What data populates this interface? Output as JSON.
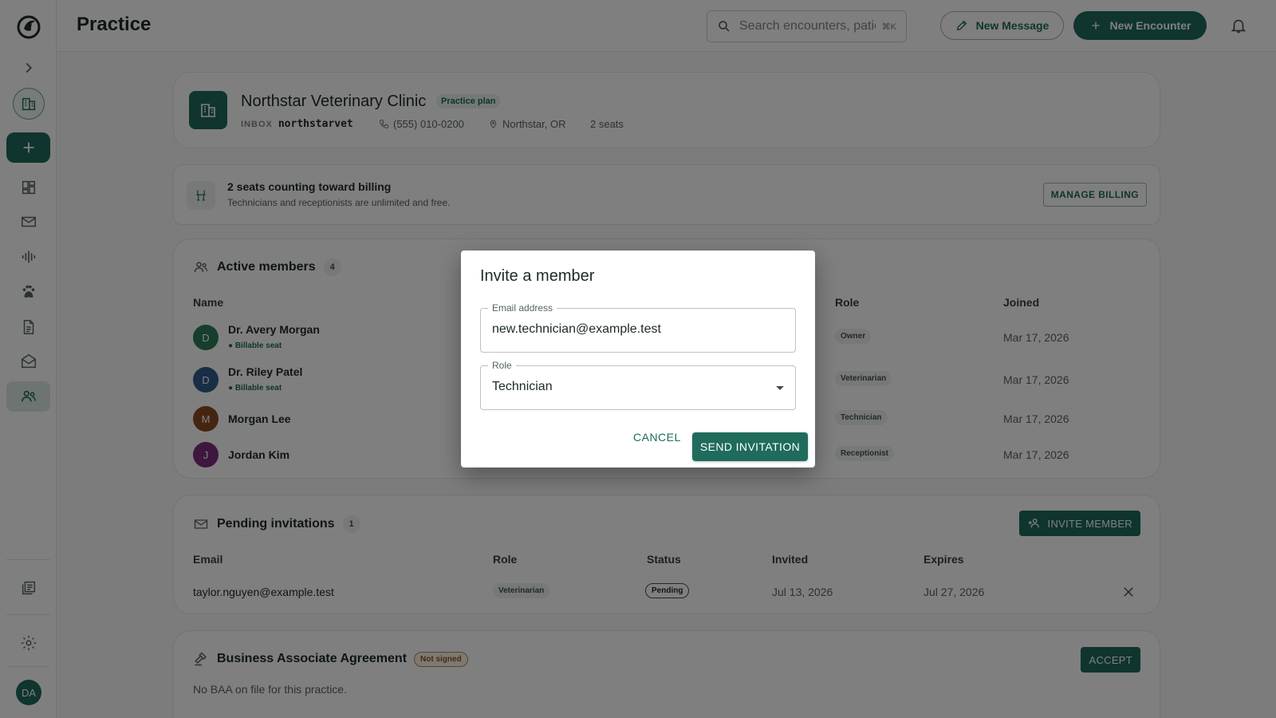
{
  "header": {
    "title": "Practice",
    "search_placeholder": "Search encounters, patients",
    "search_shortcut": "⌘K",
    "new_message_label": "New Message",
    "new_encounter_label": "New Encounter"
  },
  "sidebar": {
    "avatar_initials": "DA",
    "items": [
      {
        "icon": "chevron-right-icon"
      },
      {
        "icon": "building-icon"
      },
      {
        "icon": "plus-icon"
      },
      {
        "icon": "dashboard-icon"
      },
      {
        "icon": "mail-icon"
      },
      {
        "icon": "waveform-icon"
      },
      {
        "icon": "paw-icon"
      },
      {
        "icon": "document-icon"
      },
      {
        "icon": "drafts-icon"
      },
      {
        "icon": "people-icon"
      },
      {
        "icon": "library-icon"
      },
      {
        "icon": "gear-icon"
      }
    ]
  },
  "clinic": {
    "name": "Northstar Veterinary Clinic",
    "plan": "Practice plan",
    "inbox_label": "INBOX",
    "inbox": "northstarvet",
    "phone": "(555) 010-0200",
    "location": "Northstar, OR",
    "seats": "2 seats"
  },
  "billing": {
    "title": "2 seats counting toward billing",
    "subtitle": "Technicians and receptionists are unlimited and free.",
    "button": "MANAGE BILLING"
  },
  "members": {
    "title": "Active members",
    "count": "4",
    "columns": {
      "name": "Name",
      "role": "Role",
      "joined": "Joined"
    },
    "rows": [
      {
        "initial": "D",
        "name": "Dr. Avery Morgan",
        "seat": "Billable seat",
        "role": "Owner",
        "joined": "Mar 17, 2026",
        "color": "#2e7d5b"
      },
      {
        "initial": "D",
        "name": "Dr. Riley Patel",
        "seat": "Billable seat",
        "role": "Veterinarian",
        "joined": "Mar 17, 2026",
        "color": "#2f5d8a"
      },
      {
        "initial": "M",
        "name": "Morgan Lee",
        "seat": "",
        "role": "Technician",
        "joined": "Mar 17, 2026",
        "color": "#8a4a22"
      },
      {
        "initial": "J",
        "name": "Jordan Kim",
        "seat": "",
        "role": "Receptionist",
        "joined": "Mar 17, 2026",
        "color": "#7a2f7d"
      }
    ]
  },
  "pending": {
    "title": "Pending invitations",
    "count": "1",
    "invite_button": "INVITE MEMBER",
    "columns": {
      "email": "Email",
      "role": "Role",
      "status": "Status",
      "invited": "Invited",
      "expires": "Expires"
    },
    "rows": [
      {
        "email": "taylor.nguyen@example.test",
        "role": "Veterinarian",
        "status": "Pending",
        "invited": "Jul 13, 2026",
        "expires": "Jul 27, 2026"
      }
    ]
  },
  "baa": {
    "title": "Business Associate Agreement",
    "badge": "Not signed",
    "button": "ACCEPT",
    "text": "No BAA on file for this practice."
  },
  "modal": {
    "title": "Invite a member",
    "email_label": "Email address",
    "email_value": "new.technician@example.test",
    "role_label": "Role",
    "role_value": "Technician",
    "cancel": "CANCEL",
    "send": "SEND INVITATION"
  },
  "colors": {
    "primary": "#1f6b5c",
    "overlay": "rgba(0,0,0,0.5)"
  }
}
